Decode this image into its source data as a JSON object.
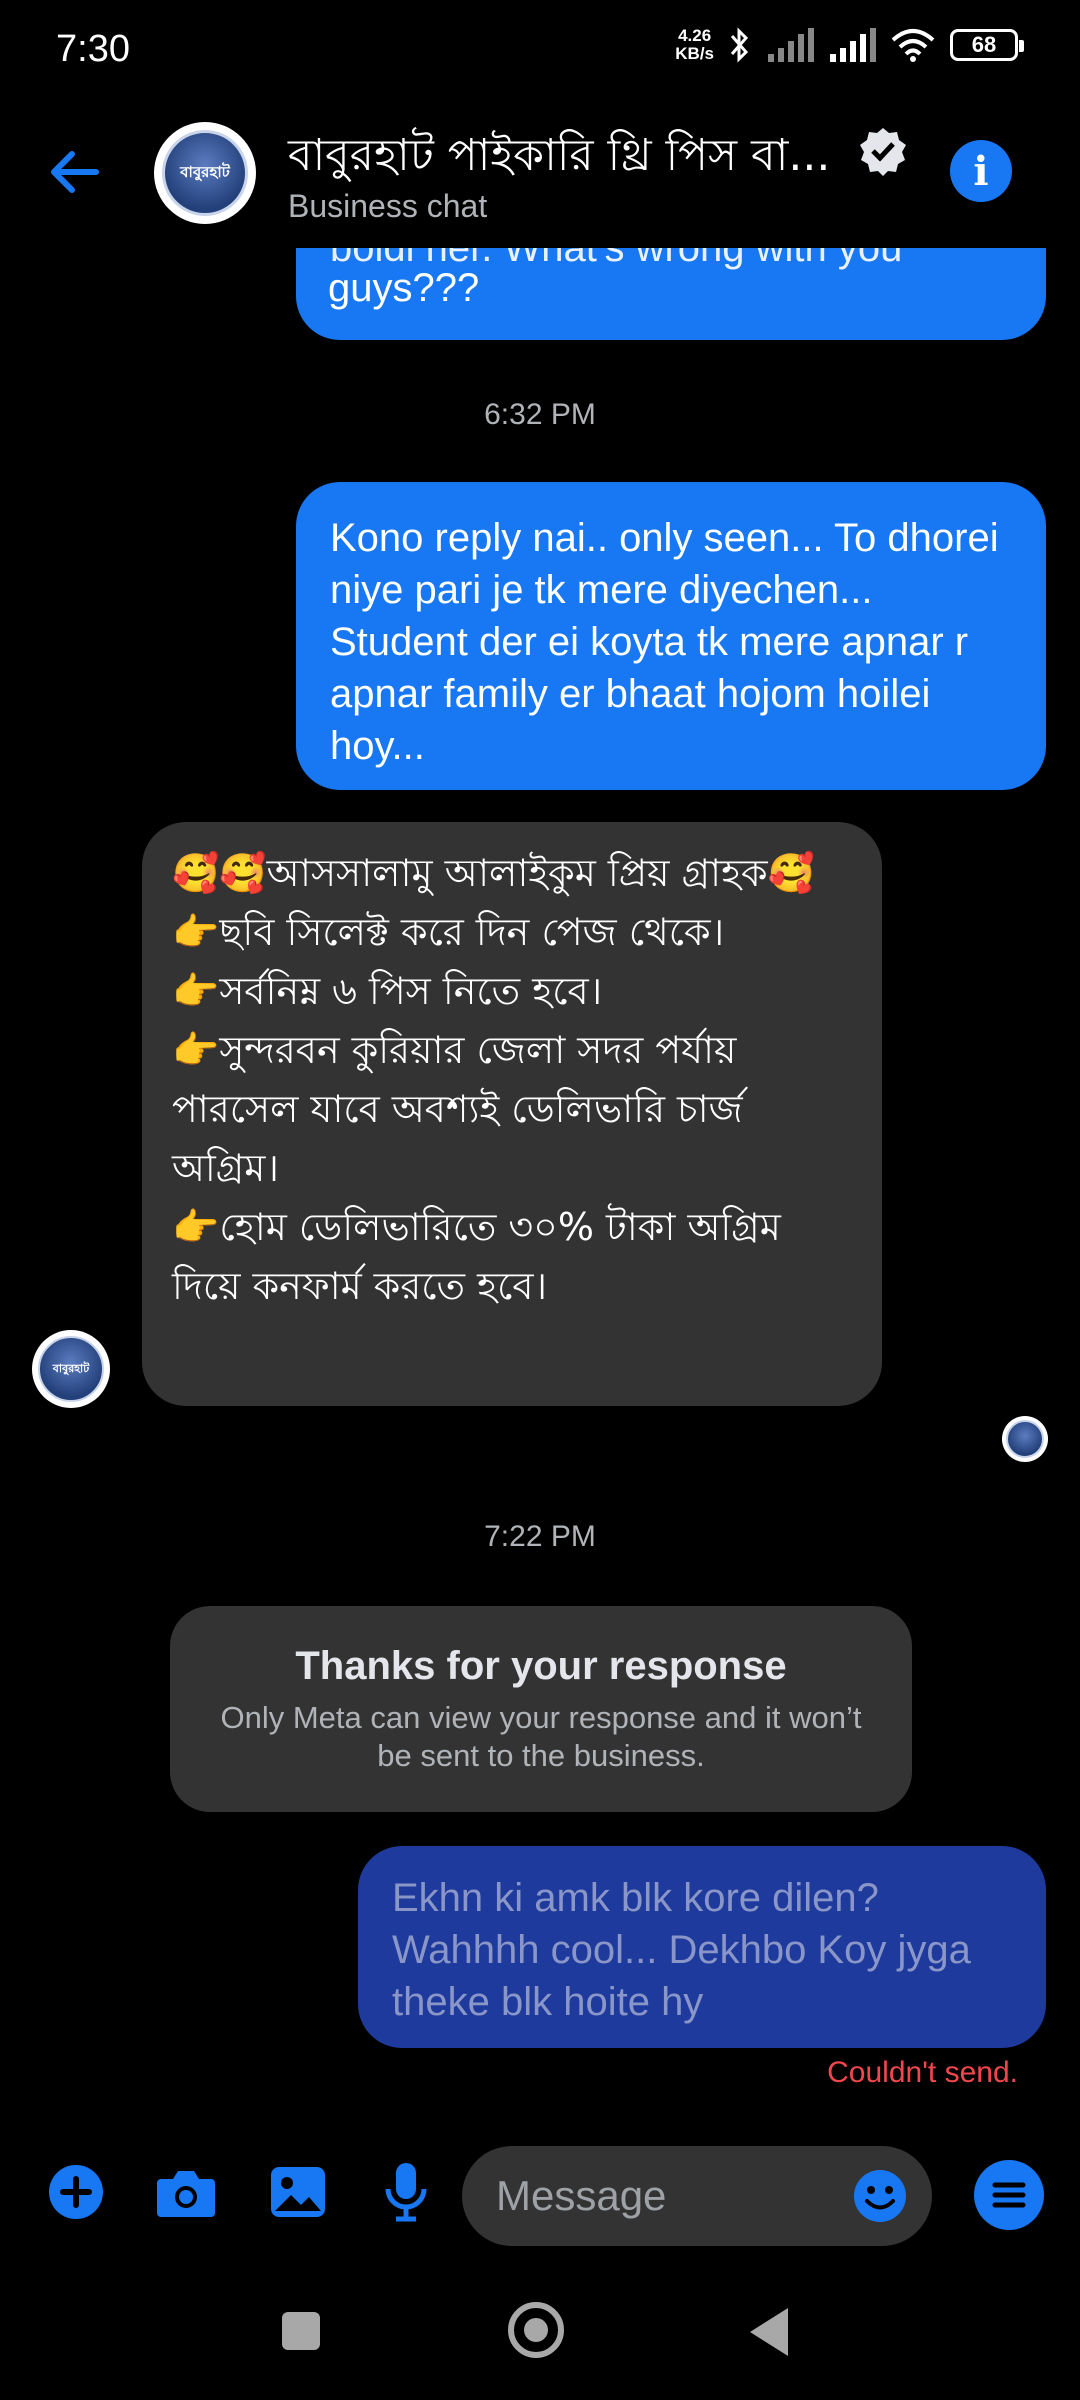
{
  "status_bar": {
    "time": "7:30",
    "net_speed_value": "4.26",
    "net_speed_unit": "KB/s",
    "battery": "68"
  },
  "header": {
    "title": "বাবুরহাট পাইকারি থ্রি পিস বা...",
    "subtitle": "Business chat",
    "avatar_text": "বাবুরহাট",
    "accent_color": "#1877f2"
  },
  "messages": {
    "partial_top": "boldi her. What's wrong with you",
    "partial_top_end": "guys???",
    "timestamp_1": "6:32 PM",
    "outgoing_1": "Kono reply nai.. only seen... To dhorei niye pari je tk mere diyechen... Student der ei koyta tk mere apnar r apnar family er bhaat hojom hoilei hoy...",
    "incoming_1": "🥰🥰আসসালামু আলাইকুম প্রিয় গ্রাহক🥰\n👉ছবি সিলেক্ট করে দিন পেজ থেকে।\n👉সর্বনিম্ন ৬ পিস নিতে হবে।\n👉সুন্দরবন কুরিয়ার জেলা সদর পর্যায় পারসেল যাবে অবশ্যই ডেলিভারি চার্জ অগ্রিম।\n👉হোম ডেলিভারিতে ৩০% টাকা অগ্রিম দিয়ে কনফার্ম করতে হবে।",
    "timestamp_2": "7:22 PM",
    "notice_title": "Thanks for your response",
    "notice_body": "Only Meta can view your response and it won’t be sent to the business.",
    "outgoing_failed": "Ekhn ki amk blk kore dilen? Wahhhh cool... Dekhbo Koy jyga theke blk hoite hy",
    "failed_label": "Couldn't send."
  },
  "composer": {
    "placeholder": "Message"
  },
  "icons": [
    "back-arrow-icon",
    "verified-badge-icon",
    "info-icon",
    "plus-icon",
    "camera-icon",
    "gallery-icon",
    "microphone-icon",
    "emoji-icon",
    "menu-icon"
  ]
}
